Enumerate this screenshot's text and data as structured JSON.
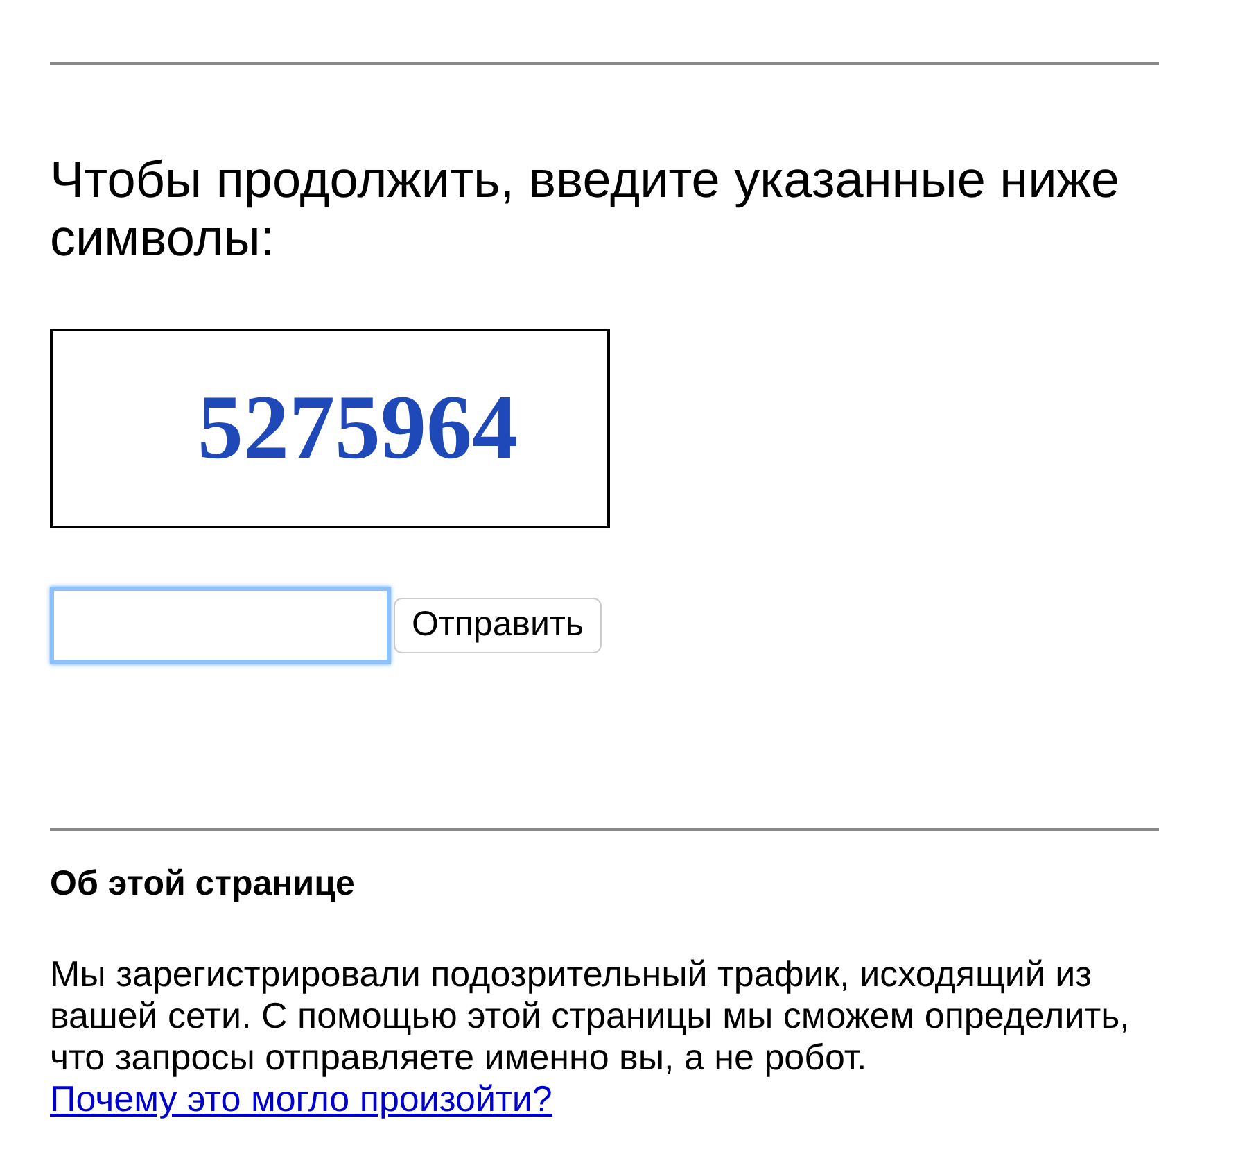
{
  "prompt": "Чтобы продолжить, введите указанные ниже символы:",
  "captcha": {
    "text": "5275964"
  },
  "answer": {
    "focused": true
  },
  "submit_button": "Отправить",
  "about": {
    "heading": "Об этой странице",
    "text": "Мы зарегистрировали подозрительный трафик, исходящий из вашей сети. С помощью этой страницы мы сможем определить, что запросы отправляете именно вы, а не робот.",
    "link": "Почему это могло произойти?"
  }
}
